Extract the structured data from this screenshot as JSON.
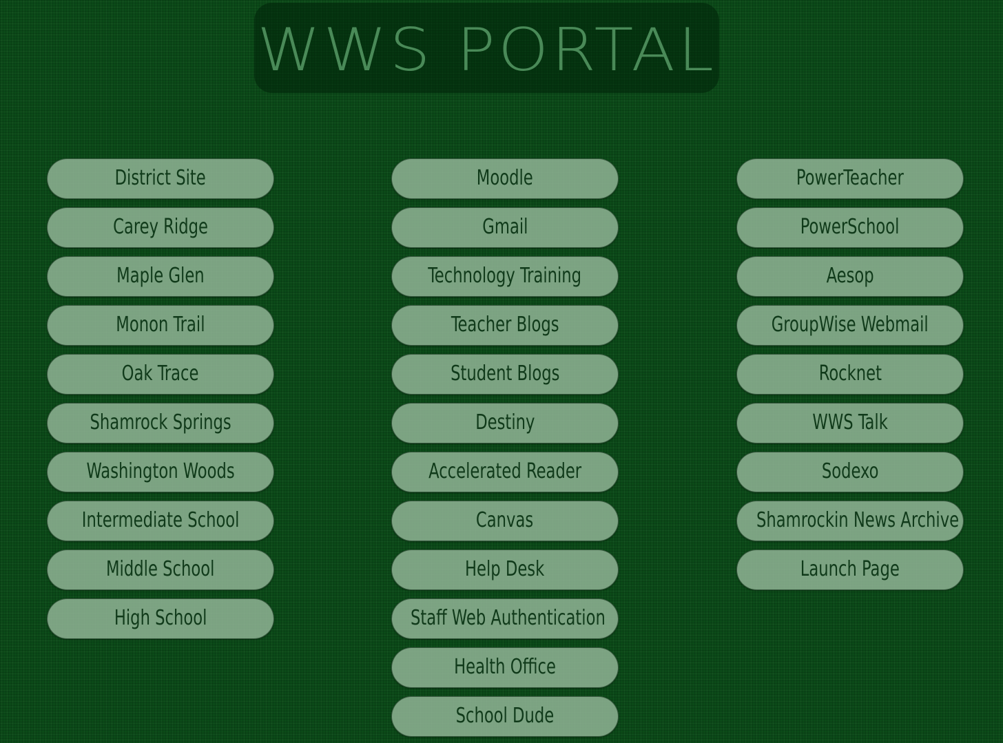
{
  "header": {
    "title": "WWS PORTAL"
  },
  "columns": {
    "left": [
      "District Site",
      "Carey Ridge",
      "Maple Glen",
      "Monon Trail",
      "Oak Trace",
      "Shamrock Springs",
      "Washington Woods",
      "Intermediate School",
      "Middle School",
      "High School"
    ],
    "middle": [
      "Moodle",
      "Gmail",
      "Technology Training",
      "Teacher Blogs",
      "Student Blogs",
      "Destiny",
      "Accelerated Reader",
      "Canvas",
      "Help Desk",
      "Staff Web Authentication",
      "Health Office",
      "School Dude"
    ],
    "right": [
      "PowerTeacher",
      "PowerSchool",
      "Aesop",
      "GroupWise Webmail",
      "Rocknet",
      "WWS Talk",
      "Sodexo",
      "Shamrockin News Archive",
      "Launch Page"
    ]
  },
  "colors": {
    "background": "#0b4a18",
    "button": "#98ba9e",
    "button_text": "#103a1a",
    "title": "#4a8a58"
  }
}
